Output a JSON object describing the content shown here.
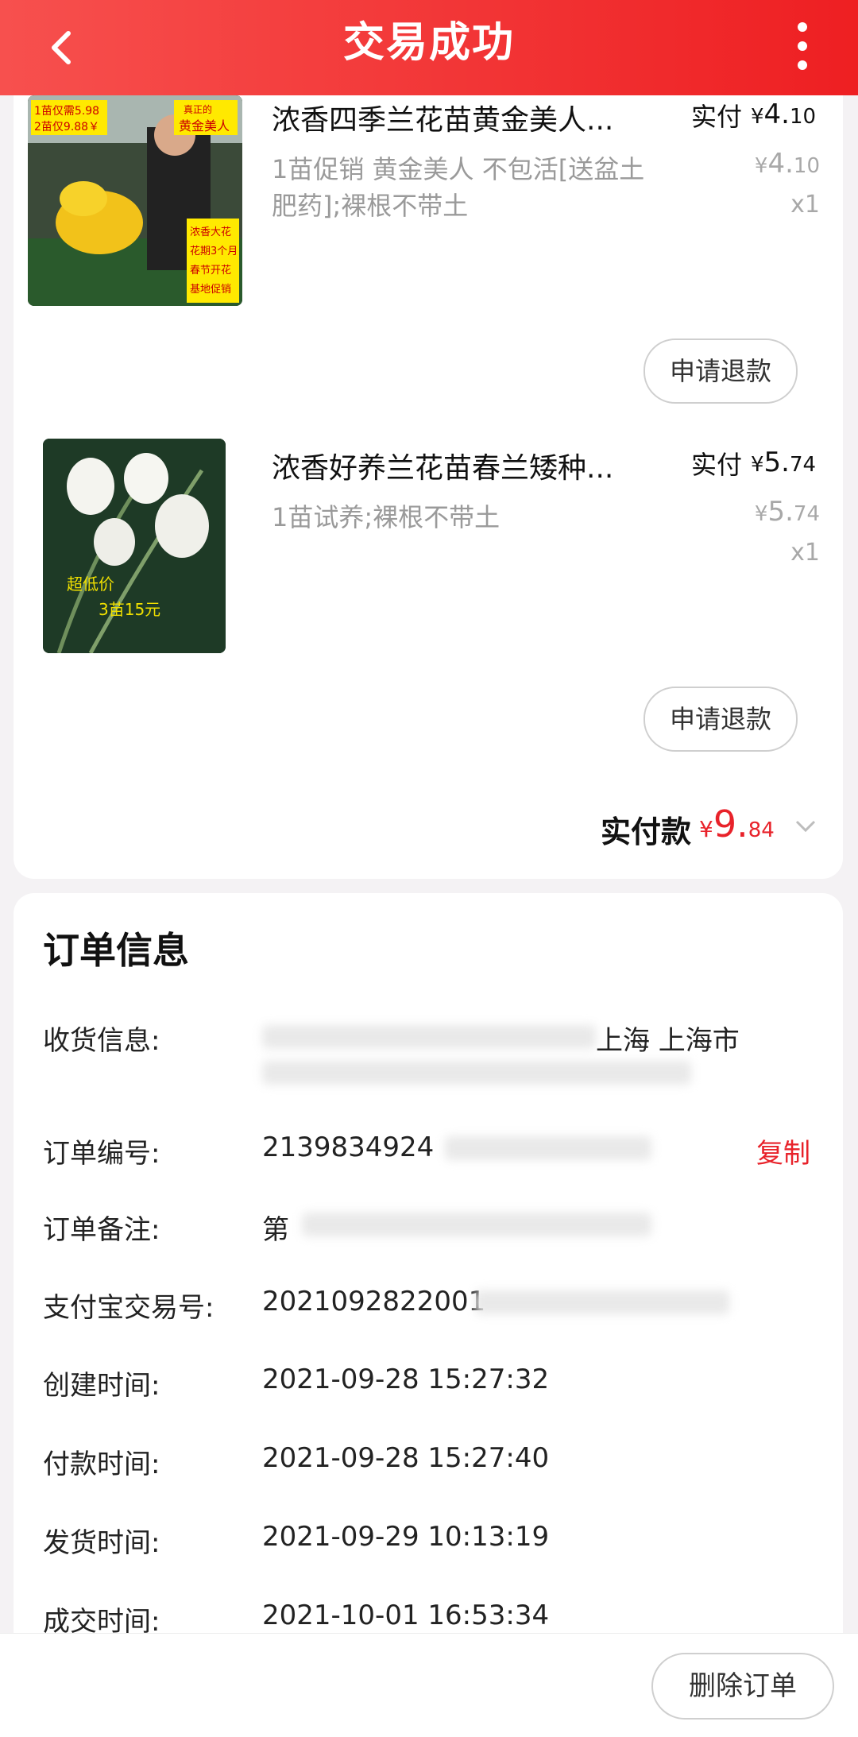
{
  "header": {
    "title": "交易成功",
    "back_icon": "chevron-left-icon",
    "more_icon": "more-vertical-icon"
  },
  "items": [
    {
      "name": "浓香四季兰花苗黄金美人...",
      "desc": "1苗促销 黄金美人 不包活[送盆土肥药];裸根不带土",
      "paid_label": "实付",
      "paid_yen": "¥",
      "paid_int": "4.",
      "paid_dec": "10",
      "orig_yen": "¥",
      "orig_int": "4.",
      "orig_dec": "10",
      "qty": "x1",
      "refund": "申请退款",
      "img_text": [
        "1苗仅需5.98",
        "2苗仅9.88￥",
        "真正的",
        "黄金美人",
        "浓香大花",
        "花期3个月",
        "春节开花",
        "基地促销"
      ]
    },
    {
      "name": "浓香好养兰花苗春兰矮种...",
      "desc": "1苗试养;裸根不带土",
      "paid_label": "实付",
      "paid_yen": "¥",
      "paid_int": "5.",
      "paid_dec": "74",
      "orig_yen": "¥",
      "orig_int": "5.",
      "orig_dec": "74",
      "qty": "x1",
      "refund": "申请退款",
      "img_text": [
        "超低价",
        "3苗15元"
      ]
    }
  ],
  "total": {
    "label": "实付款",
    "yen": "¥",
    "int": "9.",
    "dec": "84"
  },
  "order_info": {
    "title": "订单信息",
    "rows": [
      {
        "label": "收货信息:",
        "value": "上海 上海市"
      },
      {
        "label": "订单编号:",
        "value": "2139834924",
        "action": "复制"
      },
      {
        "label": "订单备注:",
        "value": "第"
      },
      {
        "label": "支付宝交易号:",
        "value": "2021092822001"
      },
      {
        "label": "创建时间:",
        "value": "2021-09-28 15:27:32"
      },
      {
        "label": "付款时间:",
        "value": "2021-09-28 15:27:40"
      },
      {
        "label": "发货时间:",
        "value": "2021-09-29 10:13:19"
      },
      {
        "label": "成交时间:",
        "value": "2021-10-01 16:53:34"
      }
    ]
  },
  "footer": {
    "delete": "删除订单"
  },
  "colors": {
    "brand": "#ee1f22",
    "price_red": "#e8222a"
  }
}
